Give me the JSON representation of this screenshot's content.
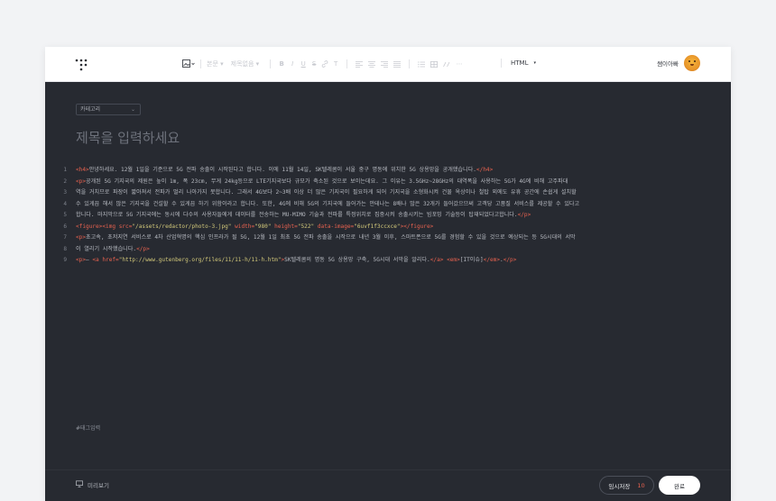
{
  "toolbar": {
    "font_size": "본문",
    "paragraph": "제목없음",
    "mode": "HTML"
  },
  "user": {
    "name": "쌤이아빠"
  },
  "editor": {
    "category": "카테고리",
    "title_placeholder": "제목을 입력하세요",
    "tag_placeholder": "#태그입력"
  },
  "code_lines": [
    {
      "n": "1",
      "t": "<h4>안녕하세요. 12월 1일을 기준으로 5G 전파 송출이 시작된다고 합니다. 이에 11월 14일, SK텔레콤이 서울 중구 명동에 위치한 5G 상용망을 공개했습니다.</h4>"
    },
    {
      "n": "2",
      "t": "<p>공개된 5G 기지국의 제원은 높이 1m, 폭 23cm, 무게 24kg등으로 LTE기지국보다 규모가 축소된 것으로 보이는데요. 그 이유는 3.5GHz~28GHz의 대역폭을 사용하는 5G가 4G에 비해 고주파대"
    },
    {
      "n": "3",
      "t": "역을 거치므로 파장이 짧아져서 전파가 멀리 나아가지 못합니다. 그래서 4G보다 2~3배 이상 더 많은 기지국이 필요하게 되어 기지국을 소형화시켜 건물 옥상이나 철탑 외에도 유휴 공간에 손쉽게 설치할"
    },
    {
      "n": "4",
      "t": "수 있게끔 해서 많은 기지국을 건설할 수 있게끔 하기 위함이라고 합니다. 또한, 4G에 비해 5G의 기지국에 들어가는 안테나는 8배나 많은 32개가 들어갔으므써 고객당 고품질 서비스를 제공할 수 있다고"
    },
    {
      "n": "5",
      "t": "합니다. 마지막으로 5G 기지국에는 동시에 다수의 사용자들에게 데이터를 전송하는 MU-MIMO 기술과 전파를 특정위치로 집중시켜 송출시키는 빔포밍 기술등이 탑재되었다고합니다.</p>"
    },
    {
      "n": "6",
      "t": "<figure><img src=\"/assets/redactor/photo-3.jpg\" width=\"980\" height=\"522\" data-image=\"6uvf1f3ccxce\"></figure>"
    },
    {
      "n": "7",
      "t": "<p>초고속, 초저지연 서비스로 4차 산업혁명의 핵심 인프라가 될 5G, 12월 1일 최초 5G 전파 송출을 시작으로 내년 3월 이후, 스마트폰으로 5G를 경험할 수 있을 것으로 예상되는 등 5G시대의 서막"
    },
    {
      "n": "8",
      "t": "이 열리기 시작했습니다.</p>"
    },
    {
      "n": "9",
      "t": "<p>— <a href=\"http://www.gutenberg.org/files/11/11-h/11-h.htm\">SK텔레콤의 명동 5G 상용망 구축, 5G시대 서막을 알리다.</a> <em>[IT이슈]</em>.</p>"
    }
  ],
  "footer": {
    "preview_label": "미리보기",
    "temp_save_label": "임시저장",
    "temp_save_count": "10",
    "done_label": "완료"
  },
  "colors": {
    "editor_bg": "#272a31",
    "tag": "#e8624f",
    "string": "#d3c97a",
    "accent": "#e8624f"
  }
}
